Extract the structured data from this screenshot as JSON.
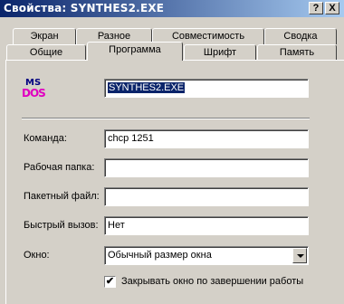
{
  "window": {
    "title": "Свойства: SYNTHES2.EXE",
    "help_button": "?",
    "close_button": "X"
  },
  "tabs": {
    "back_row": [
      "Экран",
      "Разное",
      "Совместимость",
      "Сводка"
    ],
    "front_row": [
      "Общие",
      "Программа",
      "Шрифт",
      "Память"
    ],
    "active": "Программа"
  },
  "program": {
    "icon": "ms-dos-icon",
    "icon_text_top": "MS",
    "icon_text_bottom": "DOS",
    "name": "SYNTHES2.EXE"
  },
  "fields": {
    "command_label": "Команда:",
    "command_value": "chcp 1251",
    "workdir_label": "Рабочая папка:",
    "workdir_value": "",
    "batch_label": "Пакетный файл:",
    "batch_value": "",
    "hotkey_label": "Быстрый вызов:",
    "hotkey_value": "Нет",
    "window_label": "Окно:",
    "window_value": "Обычный размер окна"
  },
  "options": {
    "close_on_exit_label": "Закрывать окно по завершении работы",
    "close_on_exit_checked": "✔"
  }
}
